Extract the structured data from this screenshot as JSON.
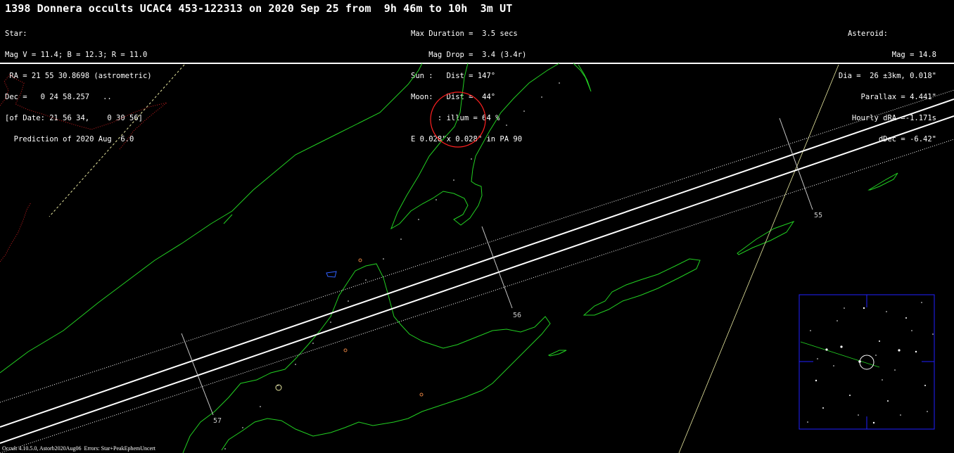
{
  "header": {
    "title": "1398 Donnera occults UCAC4 453-122313 on 2020 Sep 25 from  9h 46m to 10h  3m UT",
    "star": {
      "heading": "Star:",
      "lines": [
        "Mag V = 11.4; B = 12.3; R = 11.0",
        " RA = 21 55 30.8698 (astrometric)",
        "Dec =   0 24 58.257   ..",
        "[of Date: 21 56 34,    0 30 56]",
        "  Prediction of 2020 Aug  6.0"
      ]
    },
    "event": {
      "lines": [
        "Max Duration =  3.5 secs",
        "    Mag Drop =  3.4 (3.4r)",
        "Sun :   Dist = 147°",
        "Moon:   Dist =  44°",
        "      : illum = 64 %",
        "E 0.028\"x 0.028\" in PA 90"
      ]
    },
    "asteroid": {
      "heading": "Asteroid:",
      "lines": [
        "Mag = 14.8",
        "Dia =  26 ±3km, 0.018\"",
        "Parallax = 4.441\"",
        "Hourly dRA =-1.171s",
        "dDec = -6.42\""
      ]
    }
  },
  "map": {
    "time_ticks": [
      {
        "label": "55"
      },
      {
        "label": "56"
      },
      {
        "label": "57"
      }
    ],
    "colors": {
      "coastline": "#22d022",
      "path_center": "#ffffff",
      "path_limits": "#ffffff",
      "uncertainty": "#ffffff",
      "lake": "#3060ff",
      "site_marker": "#ff3030",
      "observer": "#e08040",
      "grid_dashed": "#e8e8a0",
      "country_border": "#d02020",
      "finder_frame": "#2020ff"
    },
    "finder_chart": {
      "label": "finder-chart"
    }
  },
  "footer": {
    "text": "Occult 4.10.5.0, Astorb2020Aug06  Errors: Star+PeakEphemUncert"
  }
}
